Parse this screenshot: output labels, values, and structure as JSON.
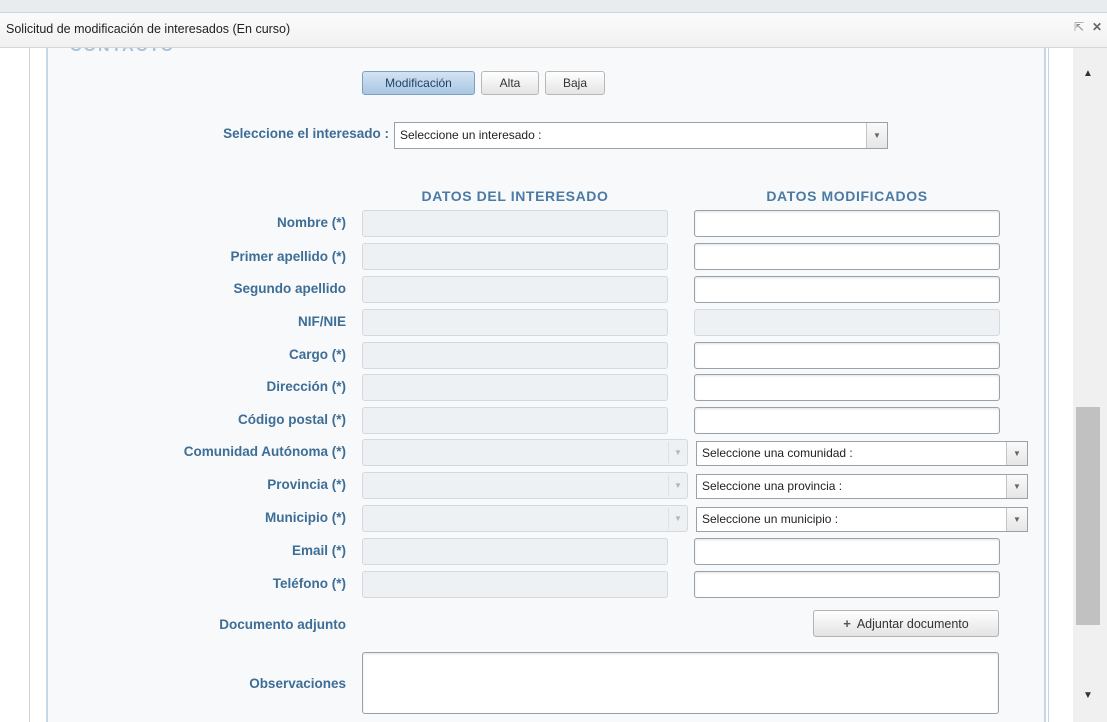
{
  "window": {
    "title": "Solicitud de modificación de interesados (En curso)",
    "icons": [
      "popout-icon",
      "close-icon"
    ]
  },
  "tabs": [
    {
      "label": "Modificación",
      "active": true
    },
    {
      "label": "Alta",
      "active": false
    },
    {
      "label": "Baja",
      "active": false
    }
  ],
  "selector": {
    "label": "Seleccione el interesado :",
    "value": "Seleccione un interesado :"
  },
  "columns": {
    "left": "DATOS DEL INTERESADO",
    "right": "DATOS MODIFICADOS"
  },
  "fields": {
    "nombre": "Nombre (*)",
    "primer_apellido": "Primer apellido (*)",
    "segundo_apellido": "Segundo apellido",
    "nif": "NIF/NIE",
    "cargo": "Cargo (*)",
    "direccion": "Dirección (*)",
    "codigo_postal": "Código postal (*)",
    "comunidad": "Comunidad Autónoma (*)",
    "provincia": "Provincia (*)",
    "municipio": "Municipio (*)",
    "email": "Email (*)",
    "telefono": "Teléfono (*)"
  },
  "selects": {
    "comunidad": "Seleccione una comunidad :",
    "provincia": "Seleccione una provincia :",
    "municipio": "Seleccione un municipio :"
  },
  "attachment": {
    "label": "Documento adjunto",
    "button": "Adjuntar documento",
    "button_icon": "plus-icon"
  },
  "observaciones": {
    "label": "Observaciones"
  },
  "colors": {
    "label": "#3e6d95",
    "column_header": "#4a7aa5",
    "active_tab": "#a9c6e3"
  }
}
